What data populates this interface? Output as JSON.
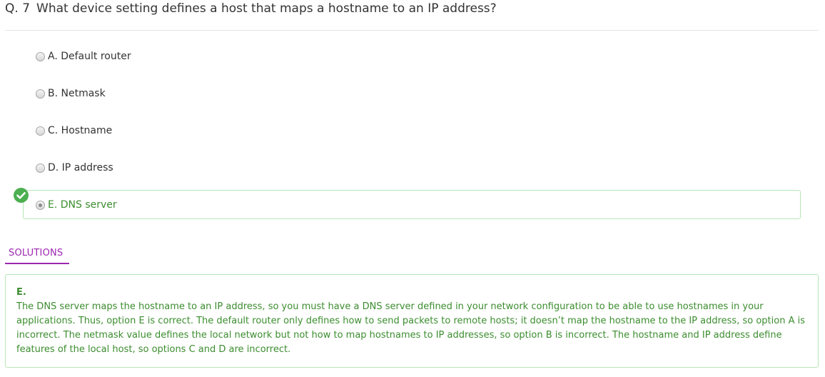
{
  "question": {
    "number": "Q. 7",
    "text": "What device setting defines a host that maps a hostname to an IP address?"
  },
  "options": [
    {
      "label": "A. Default router"
    },
    {
      "label": "B. Netmask"
    },
    {
      "label": "C. Hostname"
    },
    {
      "label": "D. IP address"
    },
    {
      "label": "E. DNS server"
    }
  ],
  "selected_option": "E",
  "correct_icon": "check-circle-icon",
  "solutions": {
    "tab_label": "SOLUTIONS",
    "answer": "E.",
    "explanation": "The DNS server maps the hostname to an IP address, so you must have a DNS server defined in your network configuration to be able to use hostnames in your applications. Thus, option E is correct. The default router only defines how to send packets to remote hosts; it doesn’t map the hostname to the IP address, so option A is incorrect. The netmask value defines the local network but not how to map hostnames to IP addresses, so option B is incorrect. The hostname and IP address define features of the local host, so options C and D are incorrect."
  },
  "colors": {
    "correct_green": "#3c8d2f",
    "badge_green": "#4caf50",
    "box_border": "#b7e6b7",
    "tab_accent": "#9c27b0",
    "text": "#333333"
  }
}
